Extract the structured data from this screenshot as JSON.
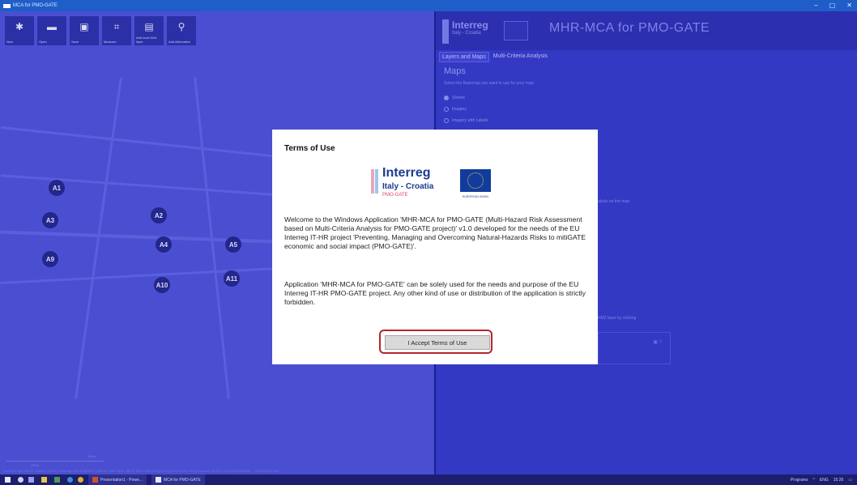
{
  "window": {
    "title": "MCA for PMO-GATE",
    "controls": [
      "–",
      "▢",
      "✕"
    ]
  },
  "toolbar": {
    "tools": [
      {
        "label": "New",
        "icon": "new-icon"
      },
      {
        "label": "Open",
        "icon": "folder-icon"
      },
      {
        "label": "Save",
        "icon": "save-icon"
      },
      {
        "label": "Measure",
        "icon": "crop-icon"
      },
      {
        "label": "Add local KML layer",
        "icon": "kml-layer-icon"
      },
      {
        "label": "Add Alternative",
        "icon": "location-pin-icon"
      }
    ]
  },
  "map": {
    "markers": [
      "A1",
      "A2",
      "A3",
      "A4",
      "A5",
      "A9",
      "A10",
      "A11"
    ],
    "scale_labels": [
      "400m",
      "100m"
    ],
    "attribution": "Sources: Esri, HERE, Garmin, USGS, Intermap, INCREMENT P, NRCan, Esri Japan, METI, Esri China (Hong Kong), Esri Korea, Esri (Thailand), NGCC, (c) OpenStreetMap ... Powered by Esri"
  },
  "panel": {
    "logo_text": "Interreg",
    "logo_sub": "Italy - Croatia",
    "app_title": "MHR-MCA for PMO-GATE",
    "tabs": [
      "Layers and Maps",
      "Multi-Criteria Analysis"
    ],
    "section_title": "Maps",
    "section_desc": "Select the Basemap you want to use for your map:",
    "basemaps": [
      {
        "label": "Streets",
        "selected": true
      },
      {
        "label": "Imagery",
        "selected": false
      },
      {
        "label": "Imagery with Labels",
        "selected": false
      }
    ],
    "side_text_1": "alysis on the map:",
    "side_text_2": "KMZ layer by clicking"
  },
  "dialog": {
    "title": "Terms of Use",
    "logo_brand": "Interreg",
    "logo_region": "Italy - Croatia",
    "logo_project": "PMO-GATE",
    "eu_label": "EUROPEAN UNION",
    "paragraph_1": "Welcome to the Windows Application 'MHR-MCA for PMO-GATE (Multi-Hazard Risk Assessment based on Multi-Criteria Analysis for PMO-GATE project)' v1.0 developed for the needs of the EU Interreg IT-HR project 'Preventing, Managing and Overcoming Natural-Hazards Risks to mitiGATE economic and social impact (PMO-GATE)'.",
    "paragraph_2": "Application 'MHR-MCA for PMO-GATE' can be solely used for the needs and purpose of the EU Interreg IT-HR PMO-GATE project. Any other kind of use or distribution of the application is strictly forbidden.",
    "accept_button": "I Accept Terms of Use"
  },
  "taskbar": {
    "running_apps": [
      "Presentation1 - Powe...",
      "MCA for PMO-GATE"
    ],
    "tray_programs": "Programs",
    "language": "ENG",
    "time": "15:26"
  }
}
